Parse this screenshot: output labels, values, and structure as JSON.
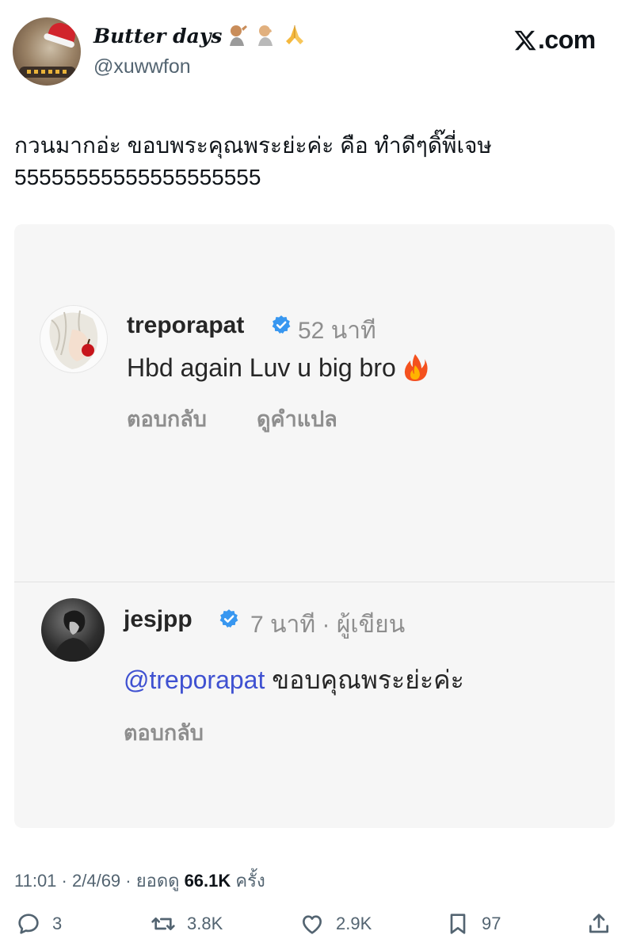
{
  "header": {
    "display_name": "Butter days",
    "emoji": [
      "palm-hand-emoji",
      "hand-over-mouth-emoji",
      "folded-hands-emoji"
    ],
    "handle": "@xuwwfon",
    "brand_x": "X",
    "brand_suffix": ".com"
  },
  "tweet": {
    "line1": "กวนมากอ่ะ ขอบพระคุณพระย่ะค่ะ คือ ทำดีๆดิ๊พี่เจษ",
    "line2": "55555555555555555555"
  },
  "embed": {
    "comment1": {
      "username": "treporapat",
      "time": "52 นาที",
      "text": "Hbd again Luv u big bro",
      "reply": "ตอบกลับ",
      "translate": "ดูคำแปล"
    },
    "comment2": {
      "username": "jesjpp",
      "time": "7 นาที",
      "author_sep": "·",
      "author_label": "ผู้เขียน",
      "mention": "@treporapat",
      "text": "ขอบคุณพระย่ะค่ะ",
      "reply": "ตอบกลับ"
    },
    "colors": {
      "verified": "#3897f0",
      "mention": "#3f51d1"
    }
  },
  "footer": {
    "time": "11:01",
    "sep": "·",
    "date": "2/4/69",
    "views_label": "ยอดดู",
    "views_value": "66.1K",
    "views_suffix": "ครั้ง"
  },
  "actions": {
    "reply_count": "3",
    "repost_count": "3.8K",
    "like_count": "2.9K",
    "bookmark_count": "97"
  }
}
